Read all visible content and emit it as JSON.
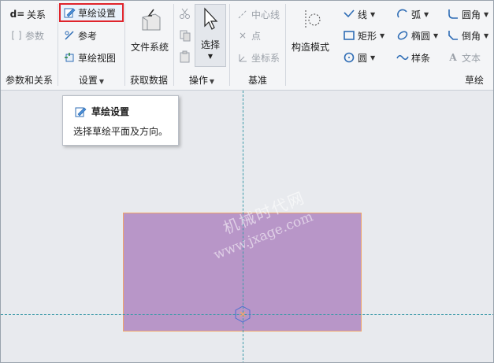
{
  "ribbon": {
    "params_group": {
      "relations_label": "关系",
      "params_label": "参数",
      "group_label": "参数和关系"
    },
    "settings_group": {
      "sketch_setup_label": "草绘设置",
      "reference_label": "参考",
      "sketch_view_label": "草绘视图",
      "group_label": "设置"
    },
    "data_group": {
      "file_system_label": "文件系统",
      "group_label": "获取数据"
    },
    "operations_group": {
      "select_label": "选择",
      "group_label": "操作"
    },
    "datum_group": {
      "centerline_label": "中心线",
      "point_label": "点",
      "coord_label": "坐标系",
      "group_label": "基准"
    },
    "sketch_group": {
      "construction_label": "构造模式",
      "line_label": "线",
      "arc_label": "弧",
      "fillet_label": "圆角",
      "rectangle_label": "矩形",
      "ellipse_label": "椭圆",
      "chamfer_label": "倒角",
      "circle_label": "圆",
      "spline_label": "样条",
      "text_label": "文本",
      "group_label": "草绘"
    }
  },
  "tooltip": {
    "title": "草绘设置",
    "description": "选择草绘平面及方向。"
  },
  "canvas": {
    "watermark_line1": "机械时代网",
    "watermark_line2": "www.jxage.com",
    "rect_fill": "#b896c8",
    "rect_edge": "#f0a46a",
    "axis_color": "#3c9aa8"
  },
  "colors": {
    "highlight": "#e0242b",
    "icon_blue": "#2f6db5"
  }
}
